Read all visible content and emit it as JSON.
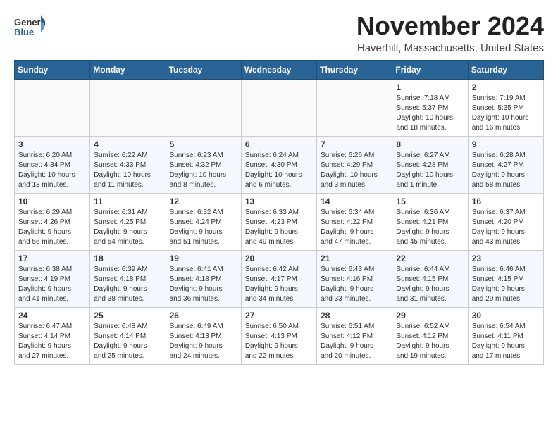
{
  "header": {
    "logo_general": "General",
    "logo_blue": "Blue",
    "month": "November 2024",
    "location": "Haverhill, Massachusetts, United States"
  },
  "weekdays": [
    "Sunday",
    "Monday",
    "Tuesday",
    "Wednesday",
    "Thursday",
    "Friday",
    "Saturday"
  ],
  "weeks": [
    [
      {
        "day": "",
        "info": ""
      },
      {
        "day": "",
        "info": ""
      },
      {
        "day": "",
        "info": ""
      },
      {
        "day": "",
        "info": ""
      },
      {
        "day": "",
        "info": ""
      },
      {
        "day": "1",
        "info": "Sunrise: 7:18 AM\nSunset: 5:37 PM\nDaylight: 10 hours\nand 18 minutes."
      },
      {
        "day": "2",
        "info": "Sunrise: 7:19 AM\nSunset: 5:35 PM\nDaylight: 10 hours\nand 16 minutes."
      }
    ],
    [
      {
        "day": "3",
        "info": "Sunrise: 6:20 AM\nSunset: 4:34 PM\nDaylight: 10 hours\nand 13 minutes."
      },
      {
        "day": "4",
        "info": "Sunrise: 6:22 AM\nSunset: 4:33 PM\nDaylight: 10 hours\nand 11 minutes."
      },
      {
        "day": "5",
        "info": "Sunrise: 6:23 AM\nSunset: 4:32 PM\nDaylight: 10 hours\nand 8 minutes."
      },
      {
        "day": "6",
        "info": "Sunrise: 6:24 AM\nSunset: 4:30 PM\nDaylight: 10 hours\nand 6 minutes."
      },
      {
        "day": "7",
        "info": "Sunrise: 6:26 AM\nSunset: 4:29 PM\nDaylight: 10 hours\nand 3 minutes."
      },
      {
        "day": "8",
        "info": "Sunrise: 6:27 AM\nSunset: 4:28 PM\nDaylight: 10 hours\nand 1 minute."
      },
      {
        "day": "9",
        "info": "Sunrise: 6:28 AM\nSunset: 4:27 PM\nDaylight: 9 hours\nand 58 minutes."
      }
    ],
    [
      {
        "day": "10",
        "info": "Sunrise: 6:29 AM\nSunset: 4:26 PM\nDaylight: 9 hours\nand 56 minutes."
      },
      {
        "day": "11",
        "info": "Sunrise: 6:31 AM\nSunset: 4:25 PM\nDaylight: 9 hours\nand 54 minutes."
      },
      {
        "day": "12",
        "info": "Sunrise: 6:32 AM\nSunset: 4:24 PM\nDaylight: 9 hours\nand 51 minutes."
      },
      {
        "day": "13",
        "info": "Sunrise: 6:33 AM\nSunset: 4:23 PM\nDaylight: 9 hours\nand 49 minutes."
      },
      {
        "day": "14",
        "info": "Sunrise: 6:34 AM\nSunset: 4:22 PM\nDaylight: 9 hours\nand 47 minutes."
      },
      {
        "day": "15",
        "info": "Sunrise: 6:36 AM\nSunset: 4:21 PM\nDaylight: 9 hours\nand 45 minutes."
      },
      {
        "day": "16",
        "info": "Sunrise: 6:37 AM\nSunset: 4:20 PM\nDaylight: 9 hours\nand 43 minutes."
      }
    ],
    [
      {
        "day": "17",
        "info": "Sunrise: 6:38 AM\nSunset: 4:19 PM\nDaylight: 9 hours\nand 41 minutes."
      },
      {
        "day": "18",
        "info": "Sunrise: 6:39 AM\nSunset: 4:18 PM\nDaylight: 9 hours\nand 38 minutes."
      },
      {
        "day": "19",
        "info": "Sunrise: 6:41 AM\nSunset: 4:18 PM\nDaylight: 9 hours\nand 36 minutes."
      },
      {
        "day": "20",
        "info": "Sunrise: 6:42 AM\nSunset: 4:17 PM\nDaylight: 9 hours\nand 34 minutes."
      },
      {
        "day": "21",
        "info": "Sunrise: 6:43 AM\nSunset: 4:16 PM\nDaylight: 9 hours\nand 33 minutes."
      },
      {
        "day": "22",
        "info": "Sunrise: 6:44 AM\nSunset: 4:15 PM\nDaylight: 9 hours\nand 31 minutes."
      },
      {
        "day": "23",
        "info": "Sunrise: 6:46 AM\nSunset: 4:15 PM\nDaylight: 9 hours\nand 29 minutes."
      }
    ],
    [
      {
        "day": "24",
        "info": "Sunrise: 6:47 AM\nSunset: 4:14 PM\nDaylight: 9 hours\nand 27 minutes."
      },
      {
        "day": "25",
        "info": "Sunrise: 6:48 AM\nSunset: 4:14 PM\nDaylight: 9 hours\nand 25 minutes."
      },
      {
        "day": "26",
        "info": "Sunrise: 6:49 AM\nSunset: 4:13 PM\nDaylight: 9 hours\nand 24 minutes."
      },
      {
        "day": "27",
        "info": "Sunrise: 6:50 AM\nSunset: 4:13 PM\nDaylight: 9 hours\nand 22 minutes."
      },
      {
        "day": "28",
        "info": "Sunrise: 6:51 AM\nSunset: 4:12 PM\nDaylight: 9 hours\nand 20 minutes."
      },
      {
        "day": "29",
        "info": "Sunrise: 6:52 AM\nSunset: 4:12 PM\nDaylight: 9 hours\nand 19 minutes."
      },
      {
        "day": "30",
        "info": "Sunrise: 6:54 AM\nSunset: 4:11 PM\nDaylight: 9 hours\nand 17 minutes."
      }
    ]
  ]
}
